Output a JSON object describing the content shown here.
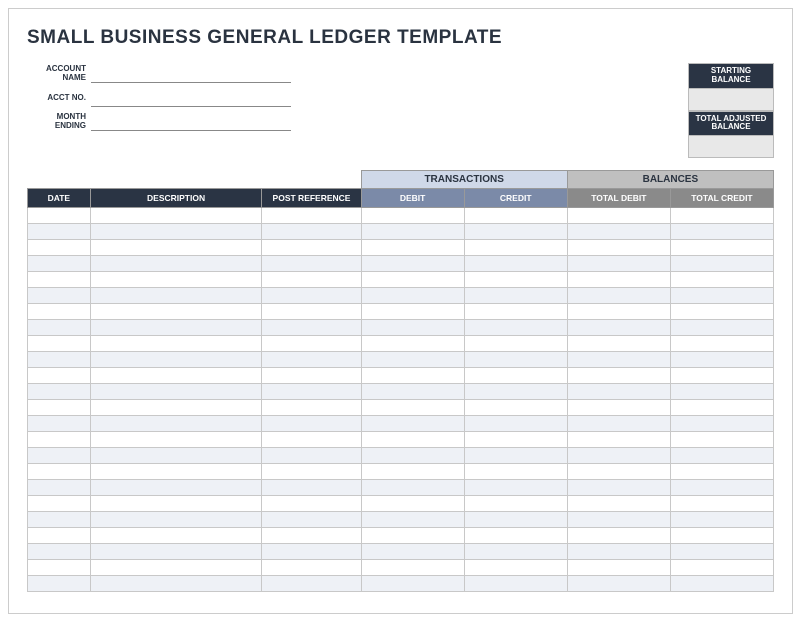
{
  "title": "SMALL BUSINESS GENERAL LEDGER TEMPLATE",
  "fields": {
    "account_name": {
      "label": "ACCOUNT NAME",
      "value": ""
    },
    "acct_no": {
      "label": "ACCT NO.",
      "value": ""
    },
    "month_ending": {
      "label": "MONTH ENDING",
      "value": ""
    }
  },
  "balances_box": {
    "starting": {
      "label": "STARTING BALANCE",
      "value": ""
    },
    "total_adjusted": {
      "label": "TOTAL ADJUSTED BALANCE",
      "value": ""
    }
  },
  "table": {
    "group_headers": {
      "transactions": "TRANSACTIONS",
      "balances": "BALANCES"
    },
    "columns": {
      "date": "DATE",
      "description": "DESCRIPTION",
      "post_reference": "POST REFERENCE",
      "debit": "DEBIT",
      "credit": "CREDIT",
      "total_debit": "TOTAL DEBIT",
      "total_credit": "TOTAL CREDIT"
    },
    "rows": [
      {
        "date": "",
        "description": "",
        "post_reference": "",
        "debit": "",
        "credit": "",
        "total_debit": "",
        "total_credit": ""
      },
      {
        "date": "",
        "description": "",
        "post_reference": "",
        "debit": "",
        "credit": "",
        "total_debit": "",
        "total_credit": ""
      },
      {
        "date": "",
        "description": "",
        "post_reference": "",
        "debit": "",
        "credit": "",
        "total_debit": "",
        "total_credit": ""
      },
      {
        "date": "",
        "description": "",
        "post_reference": "",
        "debit": "",
        "credit": "",
        "total_debit": "",
        "total_credit": ""
      },
      {
        "date": "",
        "description": "",
        "post_reference": "",
        "debit": "",
        "credit": "",
        "total_debit": "",
        "total_credit": ""
      },
      {
        "date": "",
        "description": "",
        "post_reference": "",
        "debit": "",
        "credit": "",
        "total_debit": "",
        "total_credit": ""
      },
      {
        "date": "",
        "description": "",
        "post_reference": "",
        "debit": "",
        "credit": "",
        "total_debit": "",
        "total_credit": ""
      },
      {
        "date": "",
        "description": "",
        "post_reference": "",
        "debit": "",
        "credit": "",
        "total_debit": "",
        "total_credit": ""
      },
      {
        "date": "",
        "description": "",
        "post_reference": "",
        "debit": "",
        "credit": "",
        "total_debit": "",
        "total_credit": ""
      },
      {
        "date": "",
        "description": "",
        "post_reference": "",
        "debit": "",
        "credit": "",
        "total_debit": "",
        "total_credit": ""
      },
      {
        "date": "",
        "description": "",
        "post_reference": "",
        "debit": "",
        "credit": "",
        "total_debit": "",
        "total_credit": ""
      },
      {
        "date": "",
        "description": "",
        "post_reference": "",
        "debit": "",
        "credit": "",
        "total_debit": "",
        "total_credit": ""
      },
      {
        "date": "",
        "description": "",
        "post_reference": "",
        "debit": "",
        "credit": "",
        "total_debit": "",
        "total_credit": ""
      },
      {
        "date": "",
        "description": "",
        "post_reference": "",
        "debit": "",
        "credit": "",
        "total_debit": "",
        "total_credit": ""
      },
      {
        "date": "",
        "description": "",
        "post_reference": "",
        "debit": "",
        "credit": "",
        "total_debit": "",
        "total_credit": ""
      },
      {
        "date": "",
        "description": "",
        "post_reference": "",
        "debit": "",
        "credit": "",
        "total_debit": "",
        "total_credit": ""
      },
      {
        "date": "",
        "description": "",
        "post_reference": "",
        "debit": "",
        "credit": "",
        "total_debit": "",
        "total_credit": ""
      },
      {
        "date": "",
        "description": "",
        "post_reference": "",
        "debit": "",
        "credit": "",
        "total_debit": "",
        "total_credit": ""
      },
      {
        "date": "",
        "description": "",
        "post_reference": "",
        "debit": "",
        "credit": "",
        "total_debit": "",
        "total_credit": ""
      },
      {
        "date": "",
        "description": "",
        "post_reference": "",
        "debit": "",
        "credit": "",
        "total_debit": "",
        "total_credit": ""
      },
      {
        "date": "",
        "description": "",
        "post_reference": "",
        "debit": "",
        "credit": "",
        "total_debit": "",
        "total_credit": ""
      },
      {
        "date": "",
        "description": "",
        "post_reference": "",
        "debit": "",
        "credit": "",
        "total_debit": "",
        "total_credit": ""
      },
      {
        "date": "",
        "description": "",
        "post_reference": "",
        "debit": "",
        "credit": "",
        "total_debit": "",
        "total_credit": ""
      },
      {
        "date": "",
        "description": "",
        "post_reference": "",
        "debit": "",
        "credit": "",
        "total_debit": "",
        "total_credit": ""
      }
    ]
  }
}
